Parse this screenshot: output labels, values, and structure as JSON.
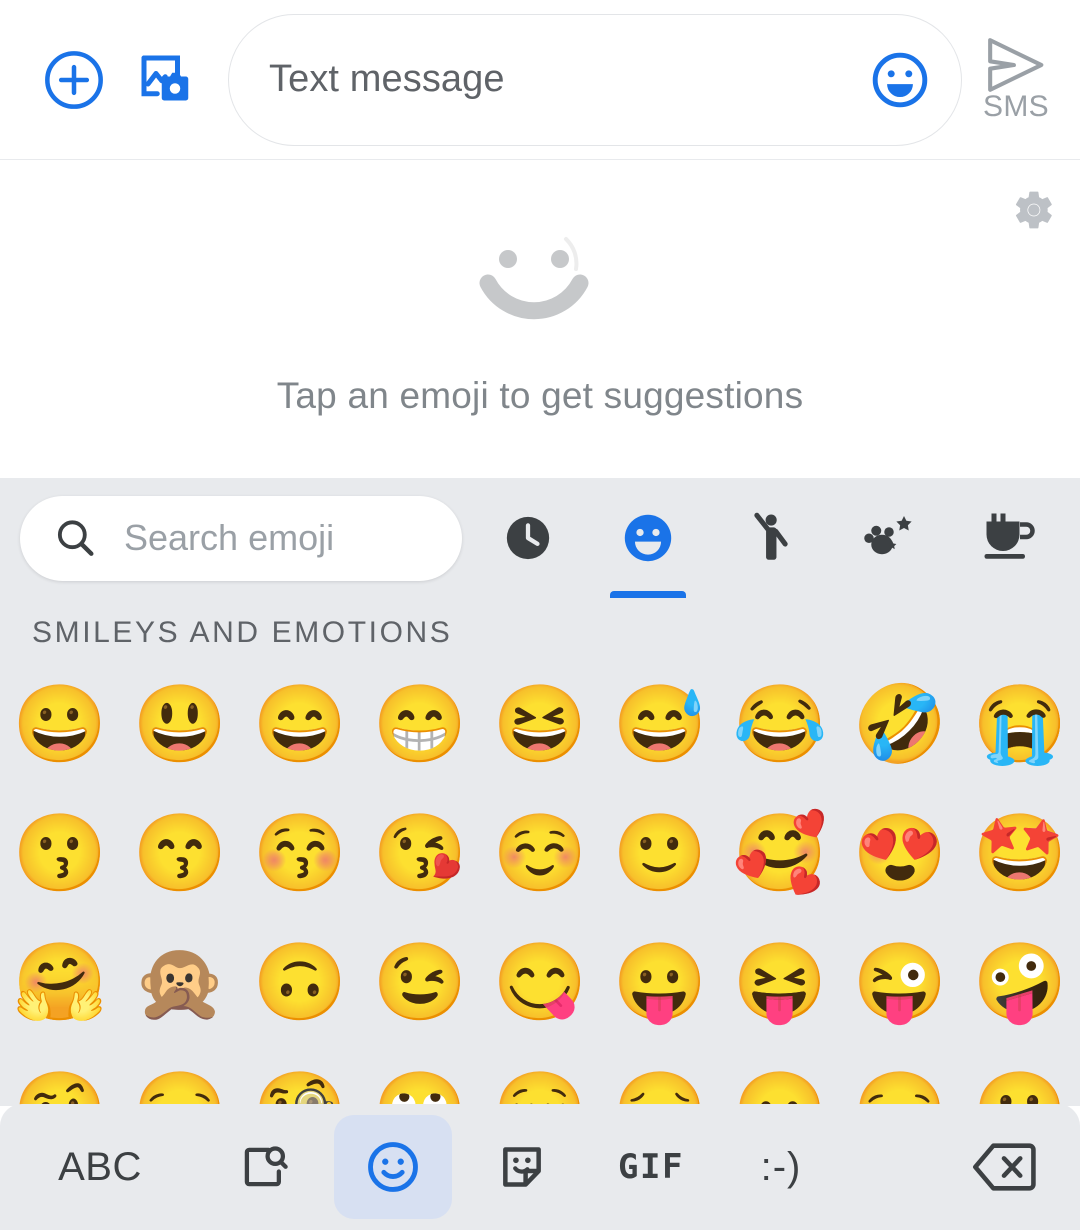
{
  "compose": {
    "plus_icon": "add-circle-icon",
    "media_icon": "gallery-camera-icon",
    "input_placeholder": "Text message",
    "input_value": "",
    "emoji_toggle_icon": "emoji-face-icon",
    "send_icon": "send-arrow-icon",
    "send_label": "SMS",
    "accent_color": "#1a73e8",
    "placeholder_color": "#5f6368"
  },
  "suggestions": {
    "settings_icon": "gear-icon",
    "illustration_icon": "big-smiley-outline-icon",
    "empty_text": "Tap an emoji to get suggestions",
    "text_color": "#80868b"
  },
  "search": {
    "icon": "search-icon",
    "placeholder": "Search emoji",
    "value": ""
  },
  "category_tabs": [
    {
      "name": "recent",
      "icon": "clock-icon",
      "active": false
    },
    {
      "name": "smileys",
      "icon": "smiley-icon",
      "active": true
    },
    {
      "name": "people",
      "icon": "person-waving-icon",
      "active": false
    },
    {
      "name": "animals-nature",
      "icon": "animal-paw-sparkle-icon",
      "active": false
    },
    {
      "name": "food-drink",
      "icon": "cup-saucer-icon",
      "active": false
    }
  ],
  "emoji_panel": {
    "section_title": "SMILEYS AND EMOTIONS",
    "columns": 9,
    "background": "#e8eaed",
    "rows": [
      [
        "😀",
        "😃",
        "😄",
        "😁",
        "😆",
        "😅",
        "😂",
        "🤣",
        "😭"
      ],
      [
        "😗",
        "😙",
        "😚",
        "😘",
        "☺️",
        "🙂",
        "🥰",
        "😍",
        "🤩"
      ],
      [
        "🤗",
        "🙊",
        "🙃",
        "😉",
        "😋",
        "😛",
        "😝",
        "😜",
        "🤪"
      ],
      [
        "🤨",
        "😏",
        "🧐",
        "🙄",
        "😌",
        "😔",
        "😦",
        "😒",
        "🙁"
      ]
    ]
  },
  "keyboard_bar": {
    "abc_label": "ABC",
    "search_icon": "page-search-icon",
    "emoji_icon": "emoji-smiley-icon",
    "sticker_icon": "sticker-icon",
    "gif_label": "GIF",
    "kaomoji_label": ":-)",
    "backspace_icon": "backspace-icon",
    "active_key": "emoji",
    "active_key_bg": "#d7e0f2",
    "background": "#e8eaed"
  }
}
